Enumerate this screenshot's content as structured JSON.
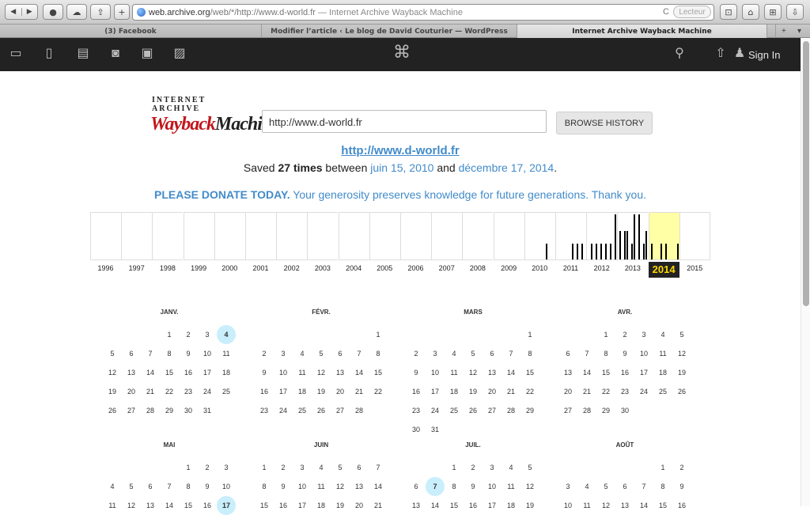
{
  "browser": {
    "nav_back": "◀",
    "nav_forward": "▶",
    "url_domain": "web.archive.org",
    "url_path": "/web/*/http://www.d-world.fr",
    "url_title": "— Internet Archive Wayback Machine",
    "reader_label": "Lecteur",
    "tabs": [
      {
        "label": "(3) Facebook",
        "active": false
      },
      {
        "label": "Modifier l’article ‹ Le blog de David Couturier — WordPress",
        "active": false
      },
      {
        "label": "Internet Archive Wayback Machine",
        "active": true
      }
    ]
  },
  "archive_nav": {
    "signin_label": "Sign In"
  },
  "logo": {
    "top": "INTERNET ARCHIVE",
    "main_a": "Wayback",
    "main_b": "Machine"
  },
  "search": {
    "value": "http://www.d-world.fr",
    "button": "BROWSE HISTORY"
  },
  "summary": {
    "site_link": "http://www.d-world.fr",
    "saved_prefix": "Saved",
    "saved_count": "27 times",
    "saved_between": "between",
    "date_start": "juin 15, 2010",
    "saved_and": "and",
    "date_end": "décembre 17, 2014",
    "saved_end": "."
  },
  "donate": {
    "bold": "PLEASE DONATE TODAY.",
    "text": "Your generosity preserves knowledge for future generations. Thank you."
  },
  "timeline": {
    "years": [
      "1996",
      "1997",
      "1998",
      "1999",
      "2000",
      "2001",
      "2002",
      "2003",
      "2004",
      "2005",
      "2006",
      "2007",
      "2008",
      "2009",
      "2010",
      "2011",
      "2012",
      "2013",
      "2014",
      "2015"
    ],
    "selected_year": "2014",
    "captures": {
      "2010": [
        {
          "m": 8,
          "h": 0.33
        }
      ],
      "2011": [
        {
          "m": 6,
          "h": 0.33
        },
        {
          "m": 8,
          "h": 0.33
        },
        {
          "m": 10,
          "h": 0.33
        }
      ],
      "2012": [
        {
          "m": 1,
          "h": 0.33
        },
        {
          "m": 3,
          "h": 0.33
        },
        {
          "m": 5,
          "h": 0.33
        },
        {
          "m": 7,
          "h": 0.33
        },
        {
          "m": 9,
          "h": 0.33
        },
        {
          "m": 11,
          "h": 0.95
        }
      ],
      "2013": [
        {
          "m": 0,
          "h": 0.6
        },
        {
          "m": 2,
          "h": 0.6
        },
        {
          "m": 3,
          "h": 0.6
        },
        {
          "m": 5,
          "h": 0.33
        },
        {
          "m": 6,
          "h": 0.95
        },
        {
          "m": 8,
          "h": 0.95
        },
        {
          "m": 10,
          "h": 0.33
        },
        {
          "m": 11,
          "h": 0.6
        }
      ],
      "2014": [
        {
          "m": 0,
          "h": 0.33
        },
        {
          "m": 4,
          "h": 0.33
        },
        {
          "m": 6,
          "h": 0.33
        },
        {
          "m": 11,
          "h": 0.33
        }
      ]
    }
  },
  "calendar": [
    {
      "name": "JANV.",
      "offset": 3,
      "days": 31,
      "hl": [
        4
      ]
    },
    {
      "name": "FÉVR.",
      "offset": 6,
      "days": 28,
      "hl": []
    },
    {
      "name": "MARS",
      "offset": 6,
      "days": 31,
      "hl": []
    },
    {
      "name": "AVR.",
      "offset": 2,
      "days": 30,
      "hl": []
    },
    {
      "name": "MAI",
      "offset": 4,
      "days": 31,
      "hl": [
        17
      ]
    },
    {
      "name": "JUIN",
      "offset": 0,
      "days": 30,
      "hl": []
    },
    {
      "name": "JUIL.",
      "offset": 2,
      "days": 31,
      "hl": [
        7
      ]
    },
    {
      "name": "AOÛT",
      "offset": 5,
      "days": 31,
      "hl": []
    }
  ]
}
